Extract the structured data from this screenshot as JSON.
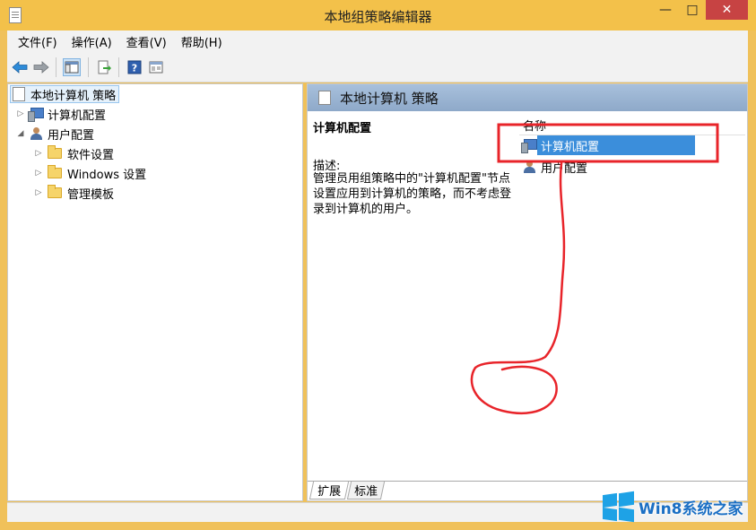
{
  "window": {
    "title": "本地组策略编辑器",
    "minimize_glyph": "—",
    "maximize_glyph": "□",
    "close_glyph": "✕"
  },
  "menubar": {
    "items": [
      "文件(F)",
      "操作(A)",
      "查看(V)",
      "帮助(H)"
    ]
  },
  "toolbar": {
    "buttons": [
      "back-arrow-icon",
      "forward-arrow-icon",
      "show-hide-console-tree-icon",
      "export-list-icon",
      "help-icon",
      "properties-icon"
    ]
  },
  "tree": {
    "root": "本地计算机 策略",
    "computer_config": "计算机配置",
    "user_config": "用户配置",
    "children": [
      "软件设置",
      "Windows 设置",
      "管理模板"
    ]
  },
  "right_pane": {
    "header": "本地计算机 策略",
    "section_title": "计算机配置",
    "desc_label": "描述:",
    "desc_text": "管理员用组策略中的\"计算机配置\"节点设置应用到计算机的策略，而不考虑登录到计算机的用户。",
    "column_header": "名称",
    "rows": [
      "计算机配置",
      "用户配置"
    ],
    "tabs": [
      "扩展",
      "标准"
    ]
  },
  "watermark": {
    "text": "Win8系统之家"
  },
  "colors": {
    "titlebar": "#f3c14a",
    "selection": "#3b8edb",
    "annotation": "#e8242a",
    "header_gradient": "#a8c0dc"
  }
}
